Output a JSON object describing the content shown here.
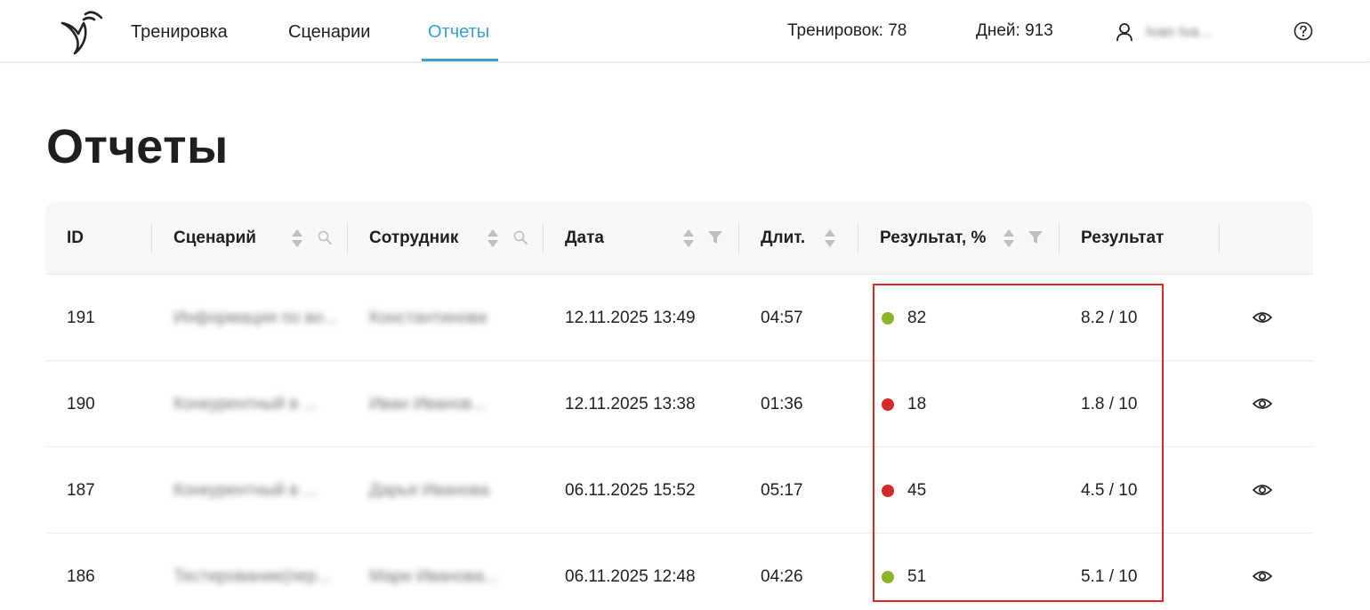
{
  "nav": {
    "items": [
      {
        "label": "Тренировка",
        "active": false
      },
      {
        "label": "Сценарии",
        "active": false
      },
      {
        "label": "Отчеты",
        "active": true
      }
    ],
    "accent_color": "#3aa0cf"
  },
  "stats": {
    "trainings": "Тренировок: 78",
    "days": "Дней: 913"
  },
  "user": {
    "icon": "user-icon",
    "name": "Ivan Iva..."
  },
  "help": {
    "icon": "help-icon"
  },
  "page": {
    "title": "Отчеты"
  },
  "table": {
    "columns": [
      {
        "label": "ID"
      },
      {
        "label": "Сценарий"
      },
      {
        "label": "Сотрудник"
      },
      {
        "label": "Дата"
      },
      {
        "label": "Длит."
      },
      {
        "label": "Результат, %"
      },
      {
        "label": "Результат"
      }
    ],
    "rows": [
      {
        "id": "191",
        "scenario": "Информация по во...",
        "employee": "Константинова",
        "date": "12.11.2025 13:49",
        "duration": "04:57",
        "percent": "82",
        "status_color": "#8db52a",
        "score": "8.2 / 10"
      },
      {
        "id": "190",
        "scenario": "Конкурентный в ...",
        "employee": "Иван Иванов...",
        "date": "12.11.2025 13:38",
        "duration": "01:36",
        "percent": "18",
        "status_color": "#d42a2a",
        "score": "1.8 / 10"
      },
      {
        "id": "187",
        "scenario": "Конкурентный в ...",
        "employee": "Дарья Иванова",
        "date": "06.11.2025 15:52",
        "duration": "05:17",
        "percent": "45",
        "status_color": "#d42a2a",
        "score": "4.5 / 10"
      },
      {
        "id": "186",
        "scenario": "Тестирование(пер...",
        "employee": "Мари Иванова...",
        "date": "06.11.2025 12:48",
        "duration": "04:26",
        "percent": "51",
        "status_color": "#8db52a",
        "score": "5.1 / 10"
      }
    ]
  },
  "highlight_color": "#d42a2a"
}
